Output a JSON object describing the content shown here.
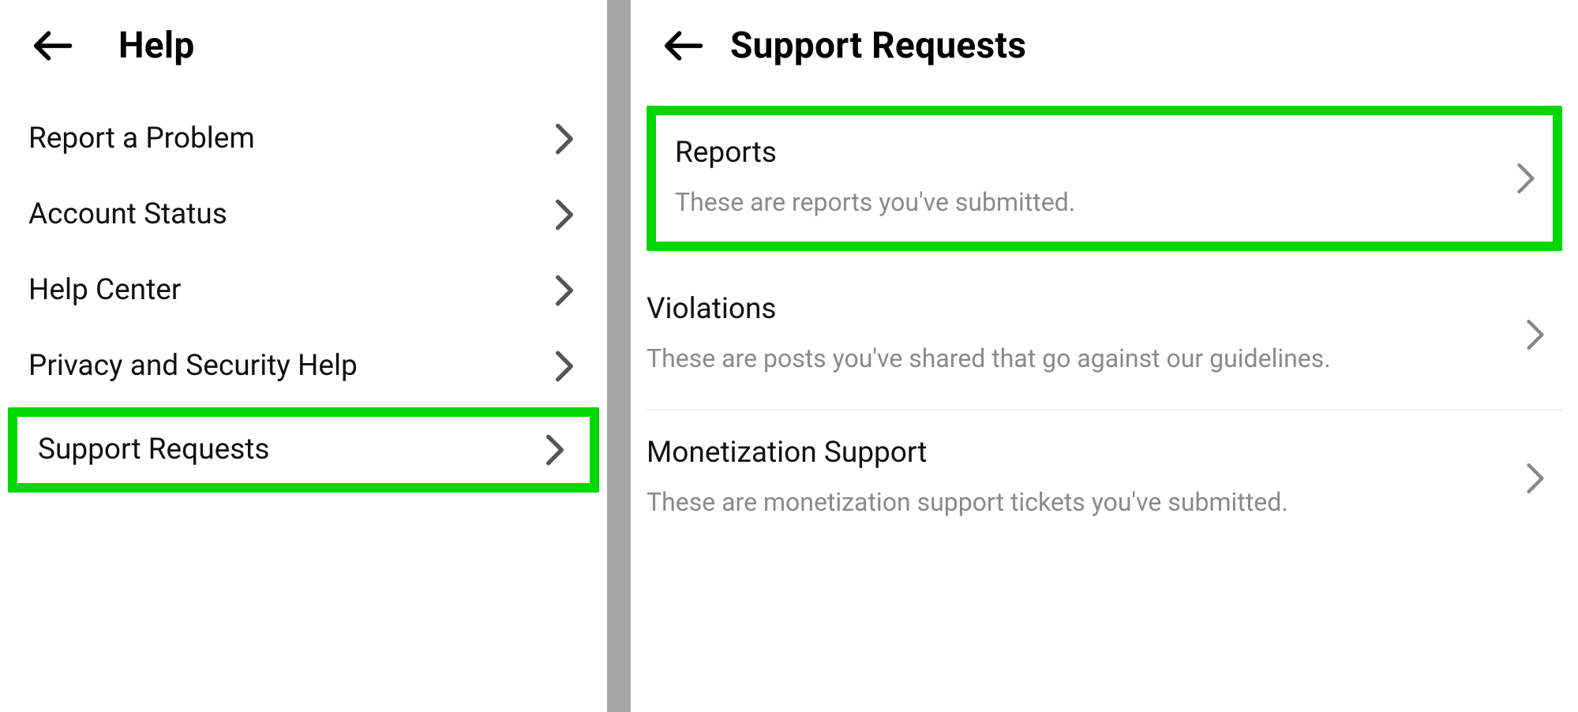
{
  "left": {
    "title": "Help",
    "items": [
      {
        "label": "Report a Problem"
      },
      {
        "label": "Account Status"
      },
      {
        "label": "Help Center"
      },
      {
        "label": "Privacy and Security Help"
      },
      {
        "label": "Support Requests"
      }
    ],
    "highlight_index": 4
  },
  "right": {
    "title": "Support Requests",
    "items": [
      {
        "title": "Reports",
        "subtitle": "These are reports you've submitted."
      },
      {
        "title": "Violations",
        "subtitle": "These are posts you've shared that go against our guidelines."
      },
      {
        "title": "Monetization Support",
        "subtitle": "These are monetization support tickets you've submitted."
      }
    ],
    "highlight_index": 0
  },
  "colors": {
    "highlight": "#00d800",
    "subtitle": "#8a8a8a",
    "divider": "#a6a6a6",
    "chevron": "#555555",
    "text": "#111111"
  }
}
